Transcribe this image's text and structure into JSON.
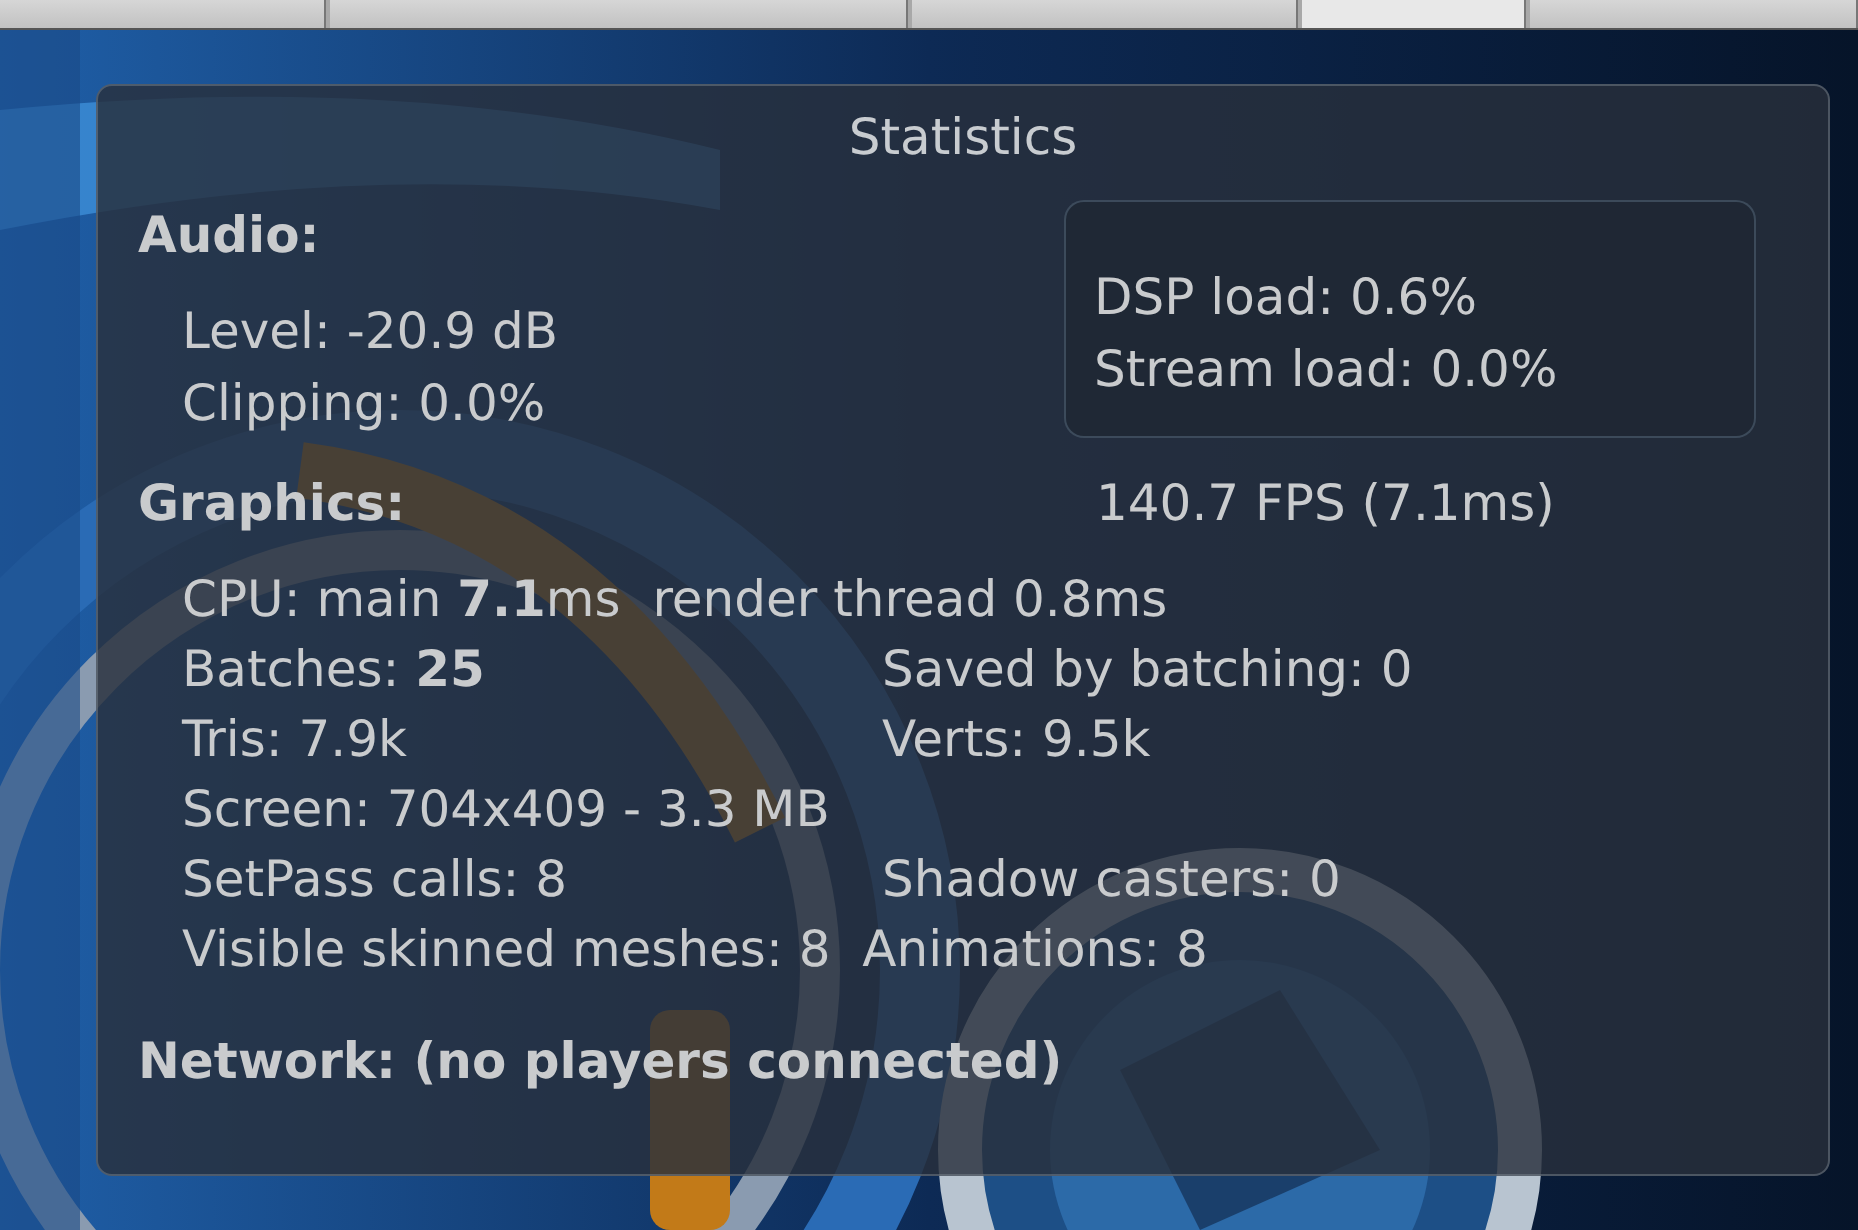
{
  "toolbar": {
    "tabs": [
      {
        "selected": false
      },
      {
        "selected": false
      },
      {
        "selected": false
      },
      {
        "selected": true
      },
      {
        "selected": false
      }
    ]
  },
  "statistics": {
    "title": "Statistics",
    "audio": {
      "heading": "Audio:",
      "left": [
        "Level: -20.9 dB",
        "Clipping: 0.0%"
      ],
      "right": [
        "DSP load: 0.6%",
        "Stream load: 0.0%"
      ]
    },
    "graphics": {
      "heading": "Graphics:",
      "fps": "140.7 FPS (7.1ms)",
      "rows": [
        {
          "left": "CPU: main **7.1**ms  render thread 0.8ms"
        },
        {
          "left": "Batches: **25**",
          "right": "Saved by batching: 0"
        },
        {
          "left": "Tris: 7.9k",
          "right": "Verts: 9.5k"
        },
        {
          "left": "Screen: 704x409 - 3.3 MB"
        },
        {
          "left": "SetPass calls: 8",
          "right": "Shadow casters: 0"
        },
        {
          "left": "Visible skinned meshes: 8  Animations: 8"
        }
      ]
    },
    "network": {
      "heading": "Network: (no players connected)"
    }
  }
}
